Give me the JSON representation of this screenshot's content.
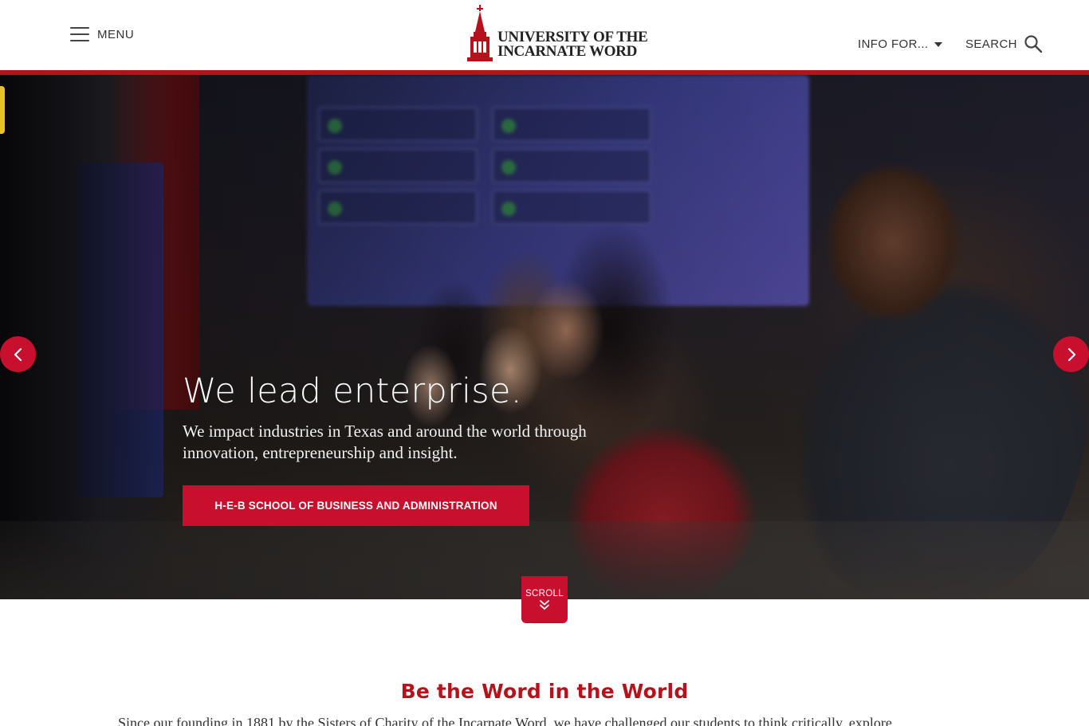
{
  "header": {
    "menu_label": "MENU",
    "logo_line1": "UNIVERSITY OF THE",
    "logo_line2": "INCARNATE WORD",
    "info_for_label": "INFO FOR...",
    "search_label": "SEARCH"
  },
  "hero": {
    "title": "We lead enterprise.",
    "subtitle": "We impact industries in Texas and around the world through innovation, entrepreneurship and insight.",
    "cta_label": "H-E-B SCHOOL OF BUSINESS AND ADMINISTRATION",
    "scroll_label": "SCROLL"
  },
  "intro": {
    "title": "Be the Word in the World",
    "text": "Since our founding in 1881 by the Sisters of Charity of the Incarnate Word, we have challenged our students to think critically, explore"
  },
  "colors": {
    "brand_red": "#c8102e",
    "rule_red": "#b5121b",
    "accent_yellow": "#e7c41f"
  }
}
